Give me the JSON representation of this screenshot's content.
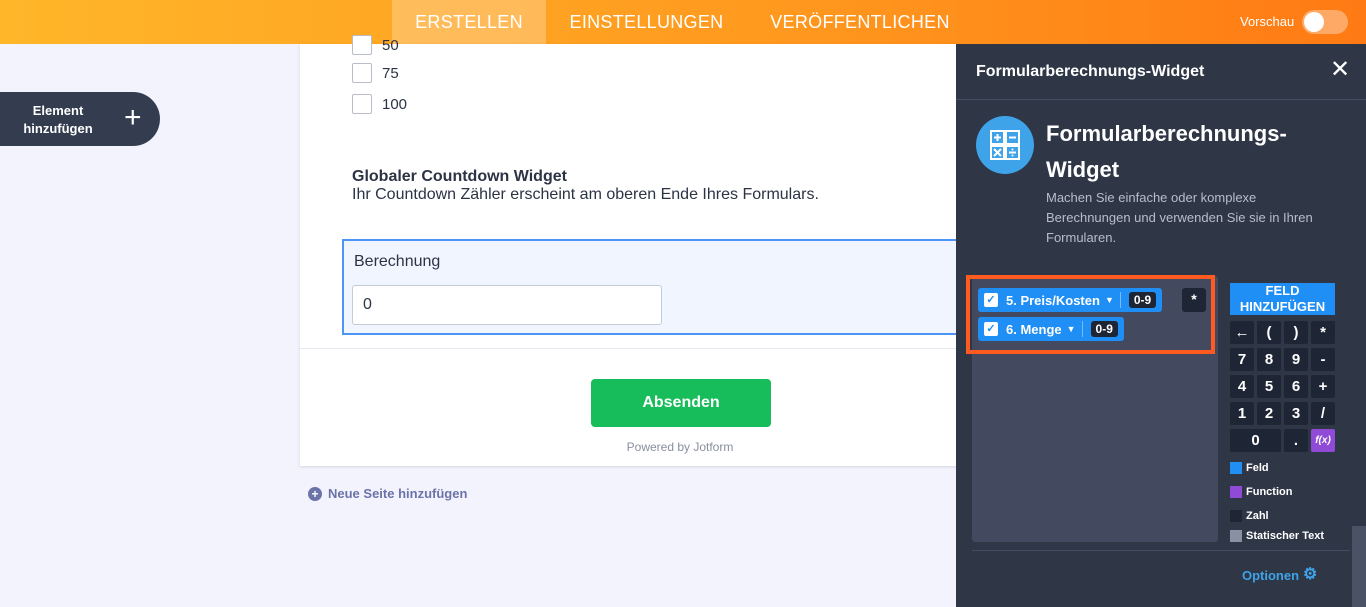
{
  "topbar": {
    "tabs": [
      "ERSTELLEN",
      "EINSTELLUNGEN",
      "VERÖFFENTLICHEN"
    ],
    "preview_label": "Vorschau",
    "preview_on": false
  },
  "add_element": {
    "label": "Element hinzufügen",
    "icon": "plus-icon"
  },
  "form": {
    "options": [
      "50",
      "75",
      "100"
    ],
    "countdown_title": "Globaler Countdown Widget",
    "countdown_desc": "Ihr Countdown Zähler erscheint am oberen Ende Ihres Formulars.",
    "calc_label": "Berechnung",
    "calc_value": "0",
    "submit_label": "Absenden",
    "powered_by": "Powered by Jotform",
    "new_page_label": "Neue Seite hinzufügen"
  },
  "panel": {
    "title": "Formularberechnungs-Widget",
    "widget_name_line1": "Formularberechnungs-",
    "widget_name_line2": "Widget",
    "description": "Machen Sie einfache oder komplexe Berechnungen und verwenden Sie sie in Ihren Formularen.",
    "tokens": [
      {
        "label": "5. Preis/Kosten",
        "range": "0-9"
      },
      {
        "label": "6. Menge",
        "range": "0-9"
      }
    ],
    "operator": "*",
    "add_field_label_1": "FELD",
    "add_field_label_2": "HINZUFÜGEN",
    "keypad": [
      [
        "←",
        "(",
        ")",
        "*"
      ],
      [
        "7",
        "8",
        "9",
        "-"
      ],
      [
        "4",
        "5",
        "6",
        "+"
      ],
      [
        "1",
        "2",
        "3",
        "/"
      ],
      [
        "0",
        ".",
        "f(x)"
      ]
    ],
    "legend": [
      {
        "label": "Feld",
        "color": "#1f8ef5"
      },
      {
        "label": "Function",
        "color": "#8f4bd6"
      },
      {
        "label": "Zahl",
        "color": "#1e2535"
      },
      {
        "label": "Statischer Text",
        "color": "#8a90a3"
      }
    ],
    "options_label": "Optionen"
  },
  "colors": {
    "brand_orange": "#ff9a1f",
    "submit_green": "#18bd5b",
    "panel_bg": "#2f3646",
    "highlight": "#ff5a1f"
  }
}
